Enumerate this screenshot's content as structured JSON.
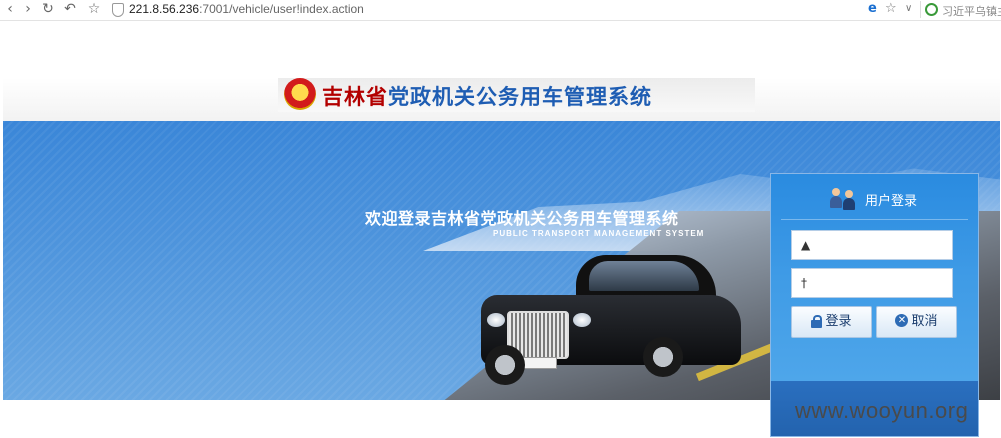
{
  "browser": {
    "url_host": "221.8.56.236",
    "url_path": ":7001/vehicle/user!index.action",
    "search_text": "习近平乌镇主",
    "icons": [
      "back-icon",
      "forward-icon",
      "reload-icon",
      "undo-icon",
      "bookmark-star-icon",
      "shield-icon",
      "ie-icon",
      "favorite-star-icon",
      "chevron-down-icon",
      "search-icon"
    ]
  },
  "header": {
    "title_province": "吉林省",
    "title_system": "党政机关公务用车管理系统"
  },
  "banner": {
    "welcome_cn": "欢迎登录吉林省党政机关公务用车管理系统",
    "welcome_en": "PUBLIC TRANSPORT MANAGEMENT SYSTEM"
  },
  "login": {
    "title": "用户登录",
    "username_value": "",
    "password_value": "",
    "login_button": "登录",
    "cancel_button": "取消"
  },
  "watermark": "www.wooyun.org",
  "colors": {
    "banner_blue": "#4c93dc",
    "title_red": "#b30000",
    "title_blue": "#1e5db3",
    "panel_blue": "#2a8be0"
  }
}
